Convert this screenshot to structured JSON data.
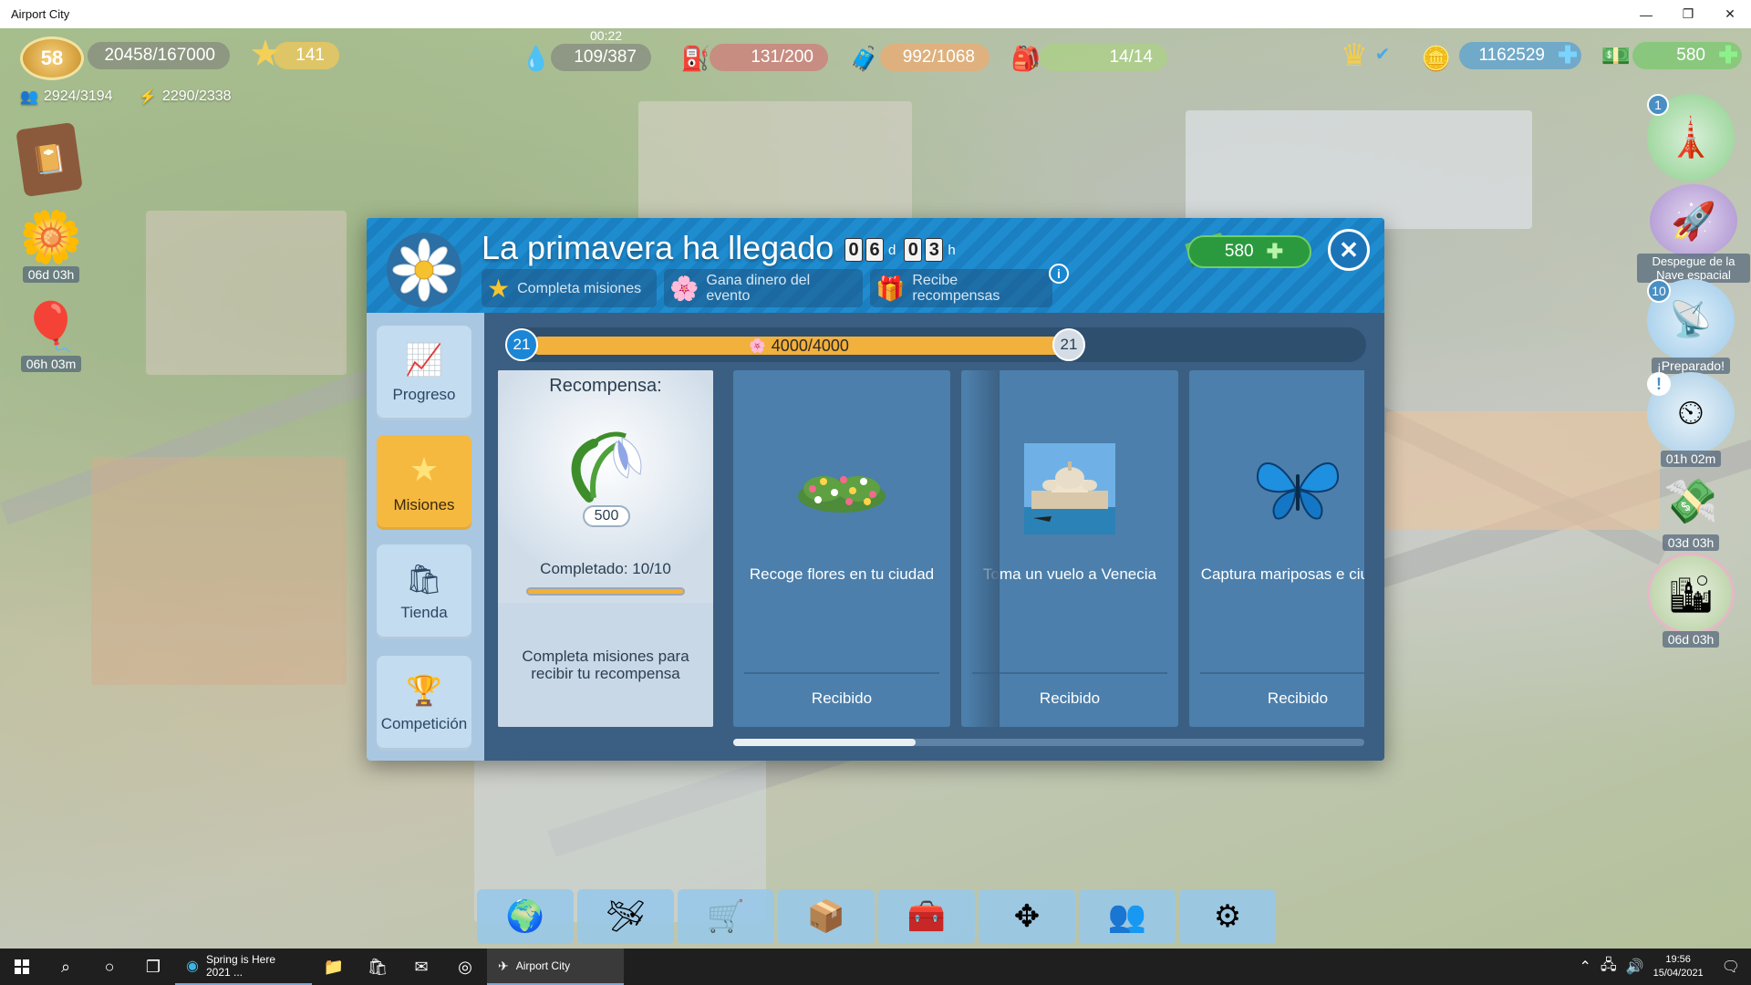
{
  "window": {
    "title": "Airport City",
    "controls": [
      "—",
      "❐",
      "✕"
    ]
  },
  "hud": {
    "level": "58",
    "xp": "20458/167000",
    "stars": "141",
    "fuel_timer": "00:22",
    "fuel": "109/387",
    "cargo": "131/200",
    "luggage": "992/1068",
    "crew": "14/14",
    "coins": "1162529",
    "cash": "580",
    "population": "2924/3194",
    "energy": "2290/2338"
  },
  "side_left": {
    "flower_timer": "06d 03h",
    "airship_timer": "06h 03m"
  },
  "side_right": {
    "radar_count": "1",
    "spaceship_label": "Despegue de la Nave espacial",
    "ready_count": "10",
    "ready_label": "¡Preparado!",
    "gauge_timer": "01h 02m",
    "money_timer": "03d 03h",
    "city_timer": "06d 03h"
  },
  "event": {
    "title": "La primavera ha llegado",
    "timer_days": [
      "0",
      "6"
    ],
    "timer_day_unit": "d",
    "timer_hours": [
      "0",
      "3"
    ],
    "timer_hour_unit": "h",
    "steps": [
      {
        "label": "Completa misiones"
      },
      {
        "label": "Gana dinero del evento"
      },
      {
        "label": "Recibe recompensas"
      }
    ],
    "info": "i",
    "cash": "580",
    "close": "✕"
  },
  "nav": [
    {
      "label": "Progreso",
      "active": false
    },
    {
      "label": "Misiones",
      "active": true
    },
    {
      "label": "Tienda",
      "active": false
    },
    {
      "label": "Competición",
      "active": false
    }
  ],
  "progress": {
    "level_left": "21",
    "level_right": "21",
    "value_text": "4000/4000",
    "fraction": 1.0
  },
  "reward": {
    "title": "Recompensa:",
    "count": "500",
    "completed": "Completado: 10/10",
    "completed_fraction": 1.0,
    "note": "Completa misiones para recibir tu recompensa"
  },
  "missions": [
    {
      "name": "Recoge flores en tu ciudad",
      "status": "Recibido",
      "icon": "flower-bush"
    },
    {
      "name": "Toma un vuelo a Venecia",
      "status": "Recibido",
      "icon": "venice-photo"
    },
    {
      "name": "Captura mariposas e ciudad",
      "status": "Recibido",
      "icon": "butterfly"
    }
  ],
  "toolbar": [
    "globe-plane",
    "hangar",
    "shop-cart",
    "crate",
    "treasure-chest",
    "move-arrows",
    "friends",
    "settings-gear"
  ],
  "taskbar": {
    "apps": [
      {
        "label": "Spring is Here 2021 ...",
        "active": false
      },
      {
        "label": "Airport City",
        "active": true
      }
    ],
    "time": "19:56",
    "date": "15/04/2021"
  },
  "colors": {
    "header_blue": "#1f8ccf",
    "dialog_bg": "#3b5f82",
    "active_tab": "#f6b940",
    "progress_fill": "#f2b03c",
    "cash_green": "#2b9a3e"
  }
}
